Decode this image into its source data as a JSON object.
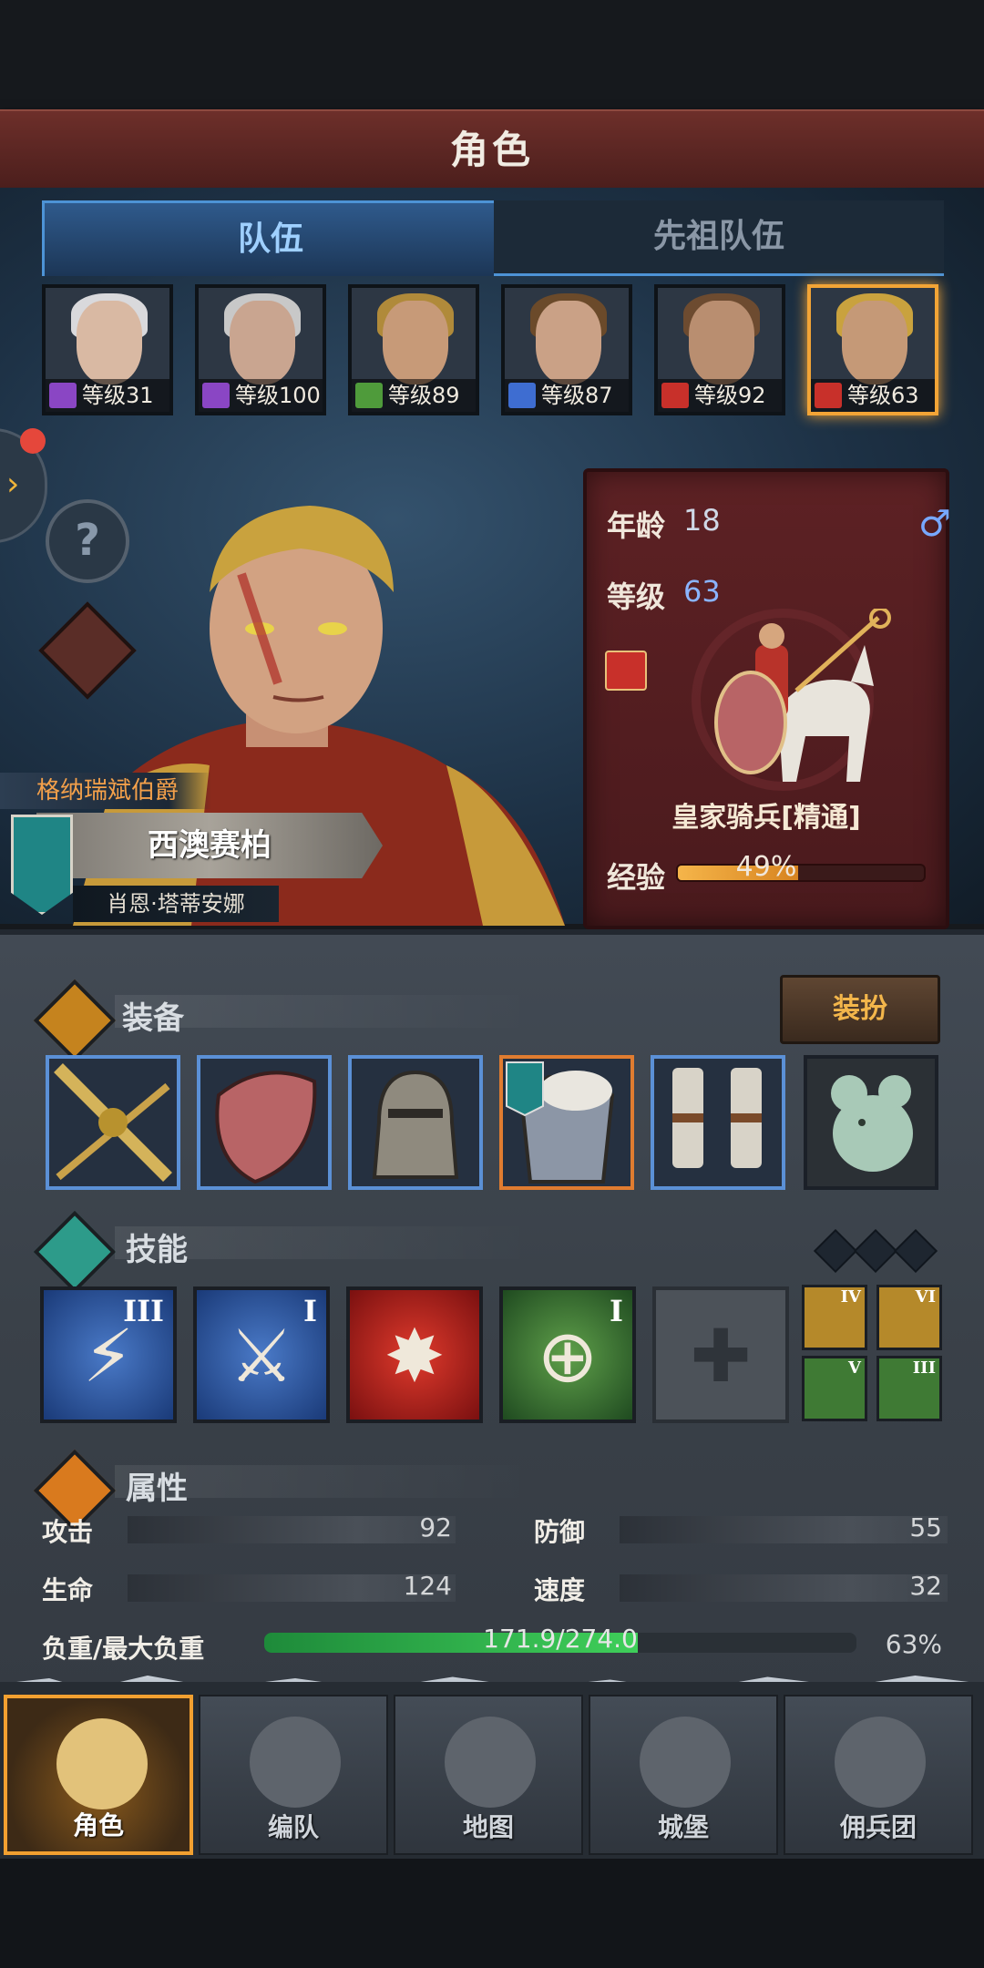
{
  "header": {
    "title": "角色"
  },
  "tabs": {
    "team": "队伍",
    "ancestor": "先祖队伍"
  },
  "heroes": [
    {
      "level": "等级31",
      "class_icon": "staff-icon",
      "hair": "#d9d9dc"
    },
    {
      "level": "等级100",
      "class_icon": "staff-icon",
      "hair": "#c8c8c8"
    },
    {
      "level": "等级89",
      "class_icon": "bow-icon",
      "hair": "#b08a3a"
    },
    {
      "level": "等级87",
      "class_icon": "sword-icon",
      "hair": "#6b4a2a"
    },
    {
      "level": "等级92",
      "class_icon": "cavalry-icon",
      "hair": "#6d4b30"
    },
    {
      "level": "等级63",
      "class_icon": "cavalry-icon",
      "hair": "#c9a23e"
    }
  ],
  "character": {
    "title": "格纳瑞斌伯爵",
    "name": "西澳赛柏",
    "spouse": "肖恩·塔蒂安娜"
  },
  "info_card": {
    "age_label": "年龄",
    "age": "18",
    "gender_symbol": "♂",
    "level_label": "等级",
    "level": "63",
    "unit": "皇家骑兵[精通]",
    "exp_label": "经验",
    "exp_text": "49%",
    "exp_percent": 49
  },
  "equipment": {
    "title": "装备",
    "dress_button": "装扮",
    "items": [
      "sword-icon",
      "shield-icon",
      "helmet-icon",
      "chest-armor-icon",
      "boots-icon",
      "mouse-charm-icon"
    ]
  },
  "skills": {
    "title": "技能",
    "main": [
      {
        "rank": "III",
        "color": "blue",
        "icon": "charge-icon"
      },
      {
        "rank": "I",
        "color": "blue",
        "icon": "strike-icon"
      },
      {
        "rank": "",
        "color": "red",
        "icon": "impact-icon"
      },
      {
        "rank": "I",
        "color": "green",
        "icon": "target-icon"
      }
    ],
    "empty_slot_icon": "cross-icon",
    "mini": [
      {
        "rank": "IV",
        "color": "gold"
      },
      {
        "rank": "VI",
        "color": "gold"
      },
      {
        "rank": "V",
        "color": "green"
      },
      {
        "rank": "III",
        "color": "green"
      }
    ]
  },
  "attributes": {
    "title": "属性",
    "attack_label": "攻击",
    "attack": "92",
    "defense_label": "防御",
    "defense": "55",
    "hp_label": "生命",
    "hp": "124",
    "speed_label": "速度",
    "speed": "32",
    "load_label": "负重/最大负重",
    "load_text": "171.9/274.0",
    "load_percent_text": "63%",
    "load_percent": 63
  },
  "nav": [
    {
      "label": "角色",
      "icon": "knight-icon",
      "active": true
    },
    {
      "label": "编队",
      "icon": "helmet-icon",
      "active": false
    },
    {
      "label": "地图",
      "icon": "compass-icon",
      "active": false
    },
    {
      "label": "城堡",
      "icon": "castle-icon",
      "active": false
    },
    {
      "label": "佣兵团",
      "icon": "mercenary-icon",
      "active": false
    }
  ]
}
